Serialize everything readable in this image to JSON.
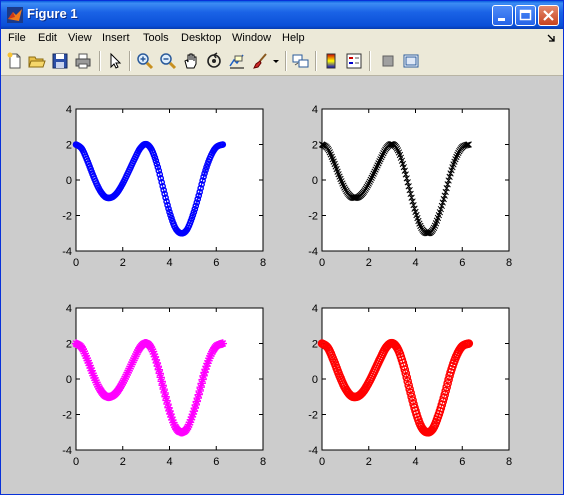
{
  "window": {
    "title": "Figure 1"
  },
  "menu": {
    "items": [
      "File",
      "Edit",
      "View",
      "Insert",
      "Tools",
      "Desktop",
      "Window",
      "Help"
    ]
  },
  "toolbar": {
    "buttons": [
      "new-figure-icon",
      "open-file-icon",
      "save-icon",
      "print-icon",
      "edit-plot-arrow-icon",
      "zoom-in-icon",
      "zoom-out-icon",
      "pan-hand-icon",
      "rotate-3d-icon",
      "data-cursor-icon",
      "brush-icon",
      "brush-dropdown-icon",
      "link-plot-icon",
      "colorbar-icon",
      "legend-icon",
      "hide-plot-tools-icon",
      "show-plot-tools-icon"
    ]
  },
  "chart_data": [
    {
      "type": "line",
      "color": "#0000ff",
      "marker": "o",
      "x": [
        0,
        0.25,
        0.5,
        0.75,
        1,
        1.25,
        1.5,
        1.75,
        2,
        2.25,
        2.5,
        2.75,
        3,
        3.25,
        3.5,
        3.75,
        4,
        4.25,
        4.5,
        4.75,
        5,
        5.25,
        5.5,
        5.75,
        6,
        6.28
      ],
      "y": [
        2.0,
        1.76,
        1.04,
        0.19,
        -0.53,
        -0.95,
        -0.99,
        -0.73,
        -0.2,
        0.47,
        1.17,
        1.79,
        2.02,
        1.67,
        0.72,
        -0.57,
        -1.8,
        -2.7,
        -3.0,
        -2.79,
        -1.98,
        -0.88,
        0.37,
        1.3,
        1.85,
        2.0
      ],
      "xlim": [
        0,
        8
      ],
      "ylim": [
        -4,
        4
      ],
      "xticks": [
        "0",
        "2",
        "4",
        "6",
        "8"
      ],
      "yticks": [
        "-4",
        "-2",
        "0",
        "2",
        "4"
      ]
    },
    {
      "type": "line",
      "color": "#000000",
      "marker": "x",
      "x": [
        0,
        0.25,
        0.5,
        0.75,
        1,
        1.25,
        1.5,
        1.75,
        2,
        2.25,
        2.5,
        2.75,
        3,
        3.25,
        3.5,
        3.75,
        4,
        4.25,
        4.5,
        4.75,
        5,
        5.25,
        5.5,
        5.75,
        6,
        6.28
      ],
      "y": [
        2.0,
        1.76,
        1.04,
        0.19,
        -0.53,
        -0.95,
        -0.99,
        -0.73,
        -0.2,
        0.47,
        1.17,
        1.79,
        2.02,
        1.67,
        0.72,
        -0.57,
        -1.8,
        -2.7,
        -3.0,
        -2.79,
        -1.98,
        -0.88,
        0.37,
        1.3,
        1.85,
        2.0
      ],
      "xlim": [
        0,
        8
      ],
      "ylim": [
        -4,
        4
      ],
      "xticks": [
        "0",
        "2",
        "4",
        "6",
        "8"
      ],
      "yticks": [
        "-4",
        "-2",
        "0",
        "2",
        "4"
      ]
    },
    {
      "type": "line",
      "color": "#ff00ff",
      "marker": "*",
      "x": [
        0,
        0.25,
        0.5,
        0.75,
        1,
        1.25,
        1.5,
        1.75,
        2,
        2.25,
        2.5,
        2.75,
        3,
        3.25,
        3.5,
        3.75,
        4,
        4.25,
        4.5,
        4.75,
        5,
        5.25,
        5.5,
        5.75,
        6,
        6.28
      ],
      "y": [
        2.0,
        1.76,
        1.04,
        0.19,
        -0.53,
        -0.95,
        -0.99,
        -0.73,
        -0.2,
        0.47,
        1.17,
        1.79,
        2.02,
        1.67,
        0.72,
        -0.57,
        -1.8,
        -2.7,
        -3.0,
        -2.79,
        -1.98,
        -0.88,
        0.37,
        1.3,
        1.85,
        2.0
      ],
      "xlim": [
        0,
        8
      ],
      "ylim": [
        -4,
        4
      ],
      "xticks": [
        "0",
        "2",
        "4",
        "6",
        "8"
      ],
      "yticks": [
        "-4",
        "-2",
        "0",
        "2",
        "4"
      ]
    },
    {
      "type": "line",
      "color": "#ff0000",
      "marker": "o",
      "x": [
        0,
        0.25,
        0.5,
        0.75,
        1,
        1.25,
        1.5,
        1.75,
        2,
        2.25,
        2.5,
        2.75,
        3,
        3.25,
        3.5,
        3.75,
        4,
        4.25,
        4.5,
        4.75,
        5,
        5.25,
        5.5,
        5.75,
        6,
        6.28
      ],
      "y": [
        2.0,
        1.76,
        1.04,
        0.19,
        -0.53,
        -0.95,
        -0.99,
        -0.73,
        -0.2,
        0.47,
        1.17,
        1.79,
        2.02,
        1.67,
        0.72,
        -0.57,
        -1.8,
        -2.7,
        -3.0,
        -2.79,
        -1.98,
        -0.88,
        0.37,
        1.3,
        1.85,
        2.0
      ],
      "xlim": [
        0,
        8
      ],
      "ylim": [
        -4,
        4
      ],
      "xticks": [
        "0",
        "2",
        "4",
        "6",
        "8"
      ],
      "yticks": [
        "-4",
        "-2",
        "0",
        "2",
        "4"
      ]
    }
  ]
}
